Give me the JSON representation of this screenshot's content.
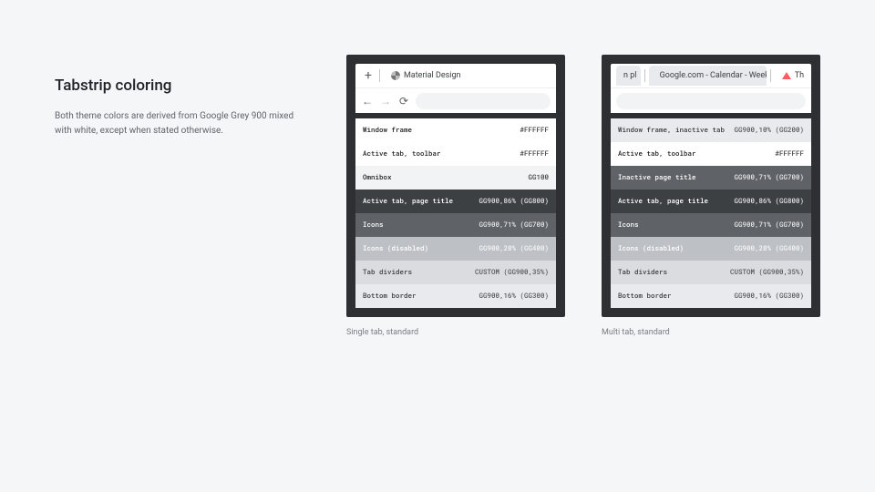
{
  "heading": "Tabstrip coloring",
  "description": "Both theme colors are derived from Google Grey 900 mixed with white, except when stated otherwise.",
  "examples": [
    {
      "caption": "Single tab, standard",
      "tabs": [
        {
          "title": "Material Design",
          "favicon": "material-icon",
          "active": true
        }
      ],
      "show_toolbar": true,
      "rows": [
        {
          "label": "Window frame",
          "value": "#FFFFFF",
          "bg": "#ffffff",
          "fg": "#202124"
        },
        {
          "label": "Active tab, toolbar",
          "value": "#FFFFFF",
          "bg": "#ffffff",
          "fg": "#202124"
        },
        {
          "label": "Omnibox",
          "value": "GG100",
          "bg": "#f1f3f4",
          "fg": "#202124"
        },
        {
          "label": "Active tab, page title",
          "value": "GG900,86% (GG800)",
          "bg": "#3c4043",
          "fg": "#ffffff"
        },
        {
          "label": "Icons",
          "value": "GG900,71% (GG700)",
          "bg": "#5f6368",
          "fg": "#ffffff"
        },
        {
          "label": "Icons (disabled)",
          "value": "GG900,28% (GG400)",
          "bg": "#bdc1c6",
          "fg": "#ffffff"
        },
        {
          "label": "Tab dividers",
          "value": "CUSTOM (GG900,35%)",
          "bg": "#dadce0",
          "fg": "#3c4043"
        },
        {
          "label": "Bottom border",
          "value": "GG900,16% (GG300)",
          "bg": "#e8eaed",
          "fg": "#3c4043"
        }
      ]
    },
    {
      "caption": "Multi tab, standard",
      "tabs": [
        {
          "title": "n pl",
          "favicon": "",
          "active": false
        },
        {
          "title": "Google.com - Calendar - Week of J",
          "favicon": "calendar-icon",
          "active": false
        },
        {
          "title": "Th",
          "favicon": "airbnb-icon",
          "active": true
        }
      ],
      "show_toolbar": true,
      "rows": [
        {
          "label": "Window frame, inactive tab",
          "value": "GG900,10% (GG200)",
          "bg": "#e8eaed",
          "fg": "#3c4043"
        },
        {
          "label": "Active tab, toolbar",
          "value": "#FFFFFF",
          "bg": "#ffffff",
          "fg": "#202124"
        },
        {
          "label": "Inactive page title",
          "value": "GG900,71% (GG700)",
          "bg": "#5f6368",
          "fg": "#ffffff"
        },
        {
          "label": "Active tab, page title",
          "value": "GG900,86% (GG800)",
          "bg": "#3c4043",
          "fg": "#ffffff"
        },
        {
          "label": "Icons",
          "value": "GG900,71% (GG700)",
          "bg": "#5f6368",
          "fg": "#ffffff"
        },
        {
          "label": "Icons (disabled)",
          "value": "GG900,28% (GG400)",
          "bg": "#bdc1c6",
          "fg": "#ffffff"
        },
        {
          "label": "Tab dividers",
          "value": "CUSTOM (GG900,35%)",
          "bg": "#dadce0",
          "fg": "#3c4043"
        },
        {
          "label": "Bottom border",
          "value": "GG900,16% (GG300)",
          "bg": "#e8eaed",
          "fg": "#3c4043"
        }
      ]
    }
  ]
}
